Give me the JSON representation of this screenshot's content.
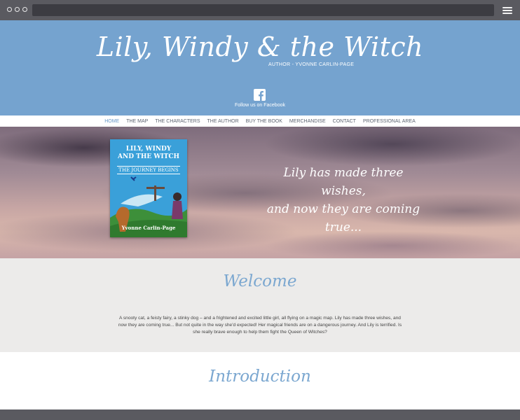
{
  "header": {
    "site_title": "Lily, Windy & the Witch",
    "tagline": "AUTHOR - YVONNE CARLIN-PAGE",
    "facebook_label": "Follow us on Facebook"
  },
  "nav": {
    "items": [
      {
        "label": "HOME",
        "active": true
      },
      {
        "label": "THE MAP"
      },
      {
        "label": "THE CHARACTERS"
      },
      {
        "label": "THE AUTHOR"
      },
      {
        "label": "BUY THE BOOK"
      },
      {
        "label": "MERCHANDISE"
      },
      {
        "label": "CONTACT"
      },
      {
        "label": "PROFESSIONAL AREA"
      }
    ]
  },
  "hero": {
    "book": {
      "title_line1": "LILY, WINDY",
      "title_line2": "AND THE WITCH",
      "subtitle": "THE JOURNEY BEGINS",
      "author": "Yvonne Carlin-Page"
    },
    "quote_line1": "Lily has made three wishes,",
    "quote_line2": "and now they are coming true..."
  },
  "welcome": {
    "heading": "Welcome",
    "text": "A snooty cat, a feisty fairy, a stinky dog – and a frightened and excited little girl, all flying on a magic map. Lily has made three wishes, and now they are coming true... But not quite in the way she'd expected! Her magical friends are on a dangerous journey. And Lily is terrified. Is she really brave enough to help them fight the Queen of Witches?"
  },
  "intro": {
    "heading": "Introduction"
  },
  "colors": {
    "header_bg": "#75a3cf",
    "accent": "#7ba7d0",
    "chrome": "#5a5a60"
  }
}
